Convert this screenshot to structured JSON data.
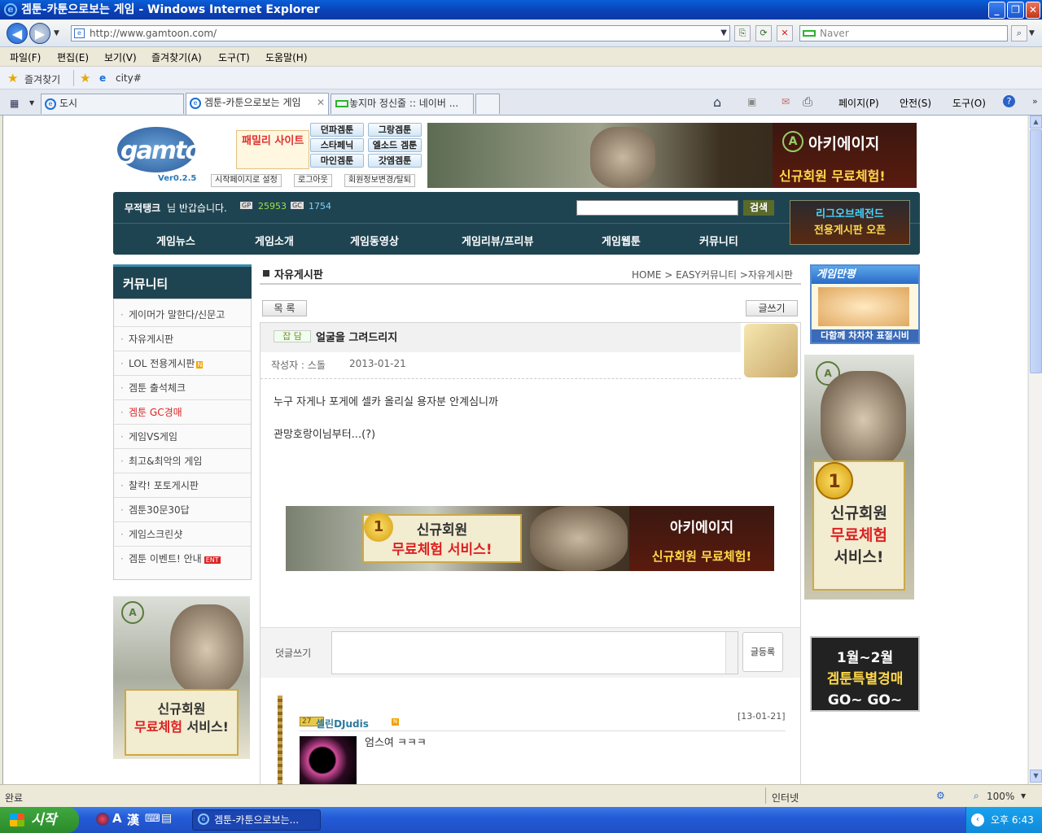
{
  "window": {
    "title": "겜툰-카툰으로보는 게임 - Windows Internet Explorer"
  },
  "address": {
    "url": "http://www.gamtoon.com/",
    "search_placeholder": "Naver"
  },
  "menu": [
    "파일(F)",
    "편집(E)",
    "보기(V)",
    "즐겨찾기(A)",
    "도구(T)",
    "도움말(H)"
  ],
  "favorites": {
    "label": "즐겨찾기",
    "item": "city#"
  },
  "tabs": [
    {
      "label": "도시"
    },
    {
      "label": "겜툰-카툰으로보는 게임"
    },
    {
      "label": "놓지마 정신줄 :: 네이버 ..."
    }
  ],
  "commands": [
    "페이지(P)",
    "안전(S)",
    "도구(O)"
  ],
  "site": {
    "logo_text": "gamtoon",
    "version": "Ver0.2.5",
    "family_site": "패밀리 사이트",
    "game_buttons": [
      "던파겜툰",
      "그랑겜툰",
      "스타페닉",
      "엘소드 겜툰",
      "마인겜툰",
      "갓엠겜툰"
    ],
    "small_buttons": [
      "시작페이지로 설정",
      "로그아웃",
      "회원정보변경/탈퇴"
    ],
    "banner_brand": "아키에이지",
    "banner_tagline": "신규회원 무료체험!",
    "greeting_name": "무적탱크",
    "greeting_suffix": "님 반갑습니다.",
    "gp_label": "GP",
    "gp_value": "25953",
    "gc_label": "GC",
    "gc_value": "1754",
    "search_button": "검색",
    "nav": [
      "게임뉴스",
      "게임소개",
      "게임동영상",
      "게임리뷰/프리뷰",
      "게임웹툰",
      "커뮤니티"
    ],
    "lol_banner": [
      "리그오브레전드",
      "전용게시판 오픈"
    ]
  },
  "sidebar": {
    "title": "커뮤니티",
    "items": [
      "게이머가 말한다/신문고",
      "자유게시판",
      "LOL 전용게시판",
      "겜툰 출석체크",
      "겜툰 GC경매",
      "게임VS게임",
      "최고&최악의 게임",
      "찰칵! 포토게시판",
      "겜툰30문30답",
      "게임스크린샷",
      "겜툰 이벤트! 안내"
    ],
    "new_badge": "N",
    "event_badge": "ENT",
    "ad_line1": "신규회원",
    "ad_line2": "무료체험",
    "ad_line3": "서비스!"
  },
  "content": {
    "board_title": "자유게시판",
    "breadcrumb": "HOME > EASY커뮤니티 >자유게시판",
    "list_button": "목 록",
    "write_button": "글쓰기",
    "category": "잡 담",
    "subject": "얼굴을 그려드리지",
    "author_label": "작성자 : 스돌",
    "date": "2013-01-21",
    "body_line1": "누구 자게나 포게에 셀카 올리실 용자분 안계심니까",
    "body_line2": "관망호랑이님부터...(?)",
    "ad_box_line1": "신규회원",
    "ad_box_line2": "무료체험 서비스!",
    "ad_brand": "아키에이지",
    "ad_tagline": "신규회원 무료체험!",
    "comment_label": "덧글쓰기",
    "comment_submit": "글등록",
    "comment": {
      "level": "27",
      "name": "셀린DJudis",
      "date": "[13-01-21]",
      "text": "엄스여 ㅋㅋㅋ"
    }
  },
  "right": {
    "manpyeong_title": "게임만평",
    "manpyeong_footer": "다함께 차차차 표절시비",
    "ad2_lines": [
      "신규회원",
      "무료체험",
      "서비스!"
    ],
    "ad2_badge": "1",
    "auction_lines": [
      "1월~2월",
      "겜툰특별경매",
      "GO~ GO~"
    ]
  },
  "status": {
    "left": "완료",
    "zone": "인터넷",
    "zoom": "100%"
  },
  "taskbar": {
    "start": "시작",
    "item": "겜툰-카툰으로보는...",
    "clock": "오후 6:43"
  }
}
